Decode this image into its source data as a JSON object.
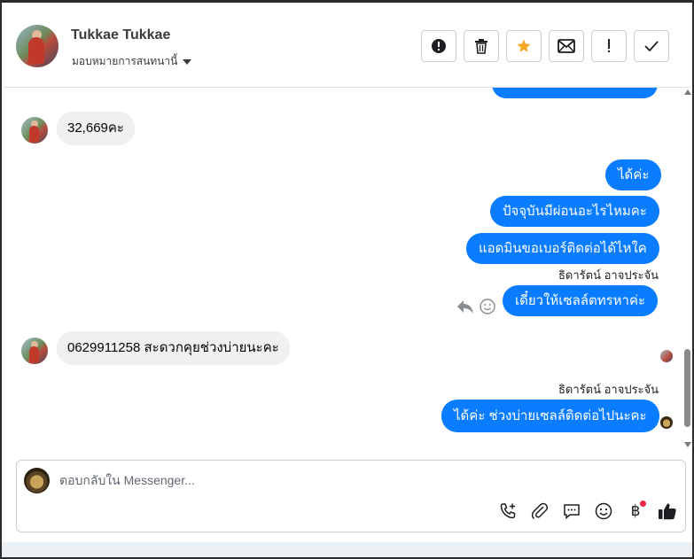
{
  "header": {
    "contact_name": "Tukkae Tukkae",
    "assign_label": "มอบหมายการสนทนานี้",
    "tools": [
      {
        "name": "spam-button",
        "icon": "alert-circle-icon"
      },
      {
        "name": "delete-button",
        "icon": "trash-icon"
      },
      {
        "name": "star-button",
        "icon": "star-icon"
      },
      {
        "name": "mark-unread-button",
        "icon": "envelope-icon"
      },
      {
        "name": "follow-up-button",
        "icon": "exclamation-icon"
      },
      {
        "name": "done-button",
        "icon": "check-icon"
      }
    ],
    "star_color": "#f5a623"
  },
  "messages": {
    "in_1": "32,669คะ",
    "out_1": "ได้ค่ะ",
    "out_2": "ปัจจุบันมีผ่อนอะไรไหมคะ",
    "out_3": "แอดมินขอเบอร์ติดต่อได้ไหใค",
    "sender_1": "ธิดารัตน์ อาจประจัน",
    "out_4": "เดี๋ยวให้เซลล์ตทรหาค่ะ",
    "in_2": "0629911258 สะดวกคุยช่วงบ่ายนะคะ",
    "sender_2": "ธิดารัตน์ อาจประจัน",
    "out_5": "ได้ค่ะ ช่วงบ่ายเซลล์ติดต่อไปนะคะ"
  },
  "composer": {
    "placeholder": "ตอบกลับใน Messenger...",
    "icons": [
      "call-add-icon",
      "attachment-icon",
      "saved-replies-icon",
      "emoji-icon",
      "baht-payment-icon",
      "thumbs-up-icon"
    ]
  },
  "colors": {
    "outgoing_bubble": "#0a7cff",
    "incoming_bubble": "#f0f0f0",
    "notification_dot": "#f02849"
  }
}
